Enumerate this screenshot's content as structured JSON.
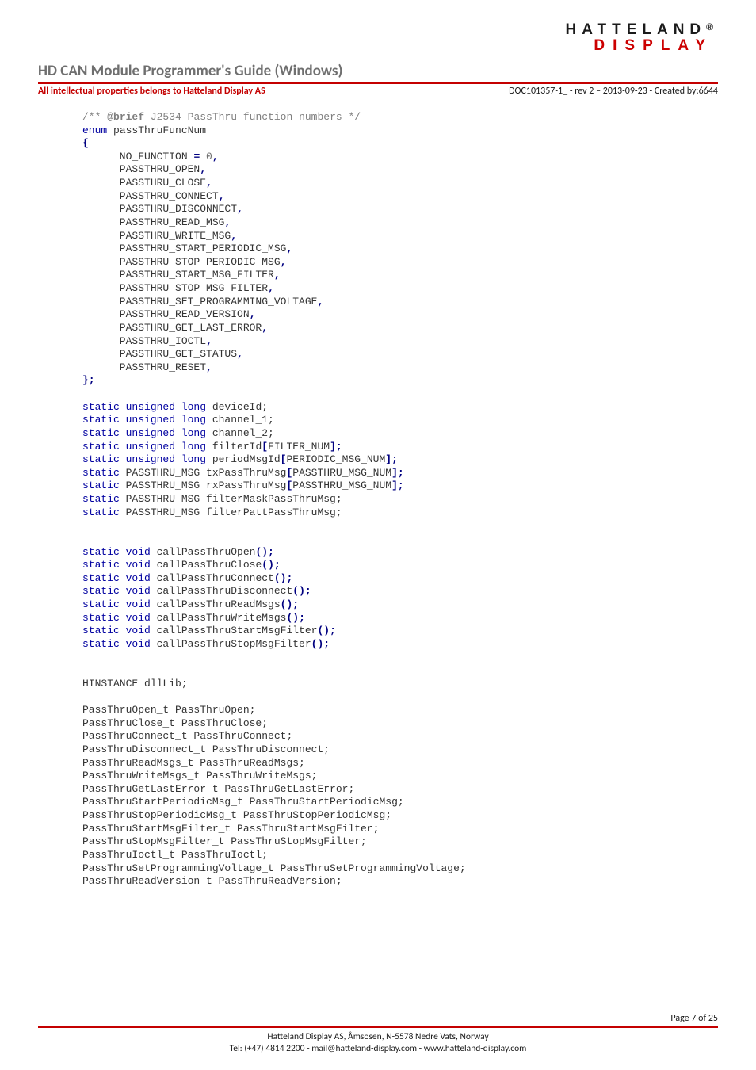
{
  "brand": {
    "line1": "HATTELAND",
    "reg": "®",
    "line2": "DISPLAY"
  },
  "header": {
    "title": "HD CAN Module Programmer's Guide (Windows)",
    "ip_line": "All intellectual properties  belongs to Hatteland Display AS",
    "docinfo": "DOC101357-1_ - rev 2 – 2013-09-23 - Created by:6644"
  },
  "code": {
    "comment_open": "/** ",
    "comment_tag": "@brief",
    "comment_text": " J2534 PassThru function numbers */",
    "enum_kw": "enum",
    "enum_name": " passThruFuncNum",
    "brace_open": "{",
    "first_item_name": "      NO_FUNCTION ",
    "eq": "=",
    "zero": " 0",
    "comma": ",",
    "enum_items": [
      "      PASSTHRU_OPEN",
      "      PASSTHRU_CLOSE",
      "      PASSTHRU_CONNECT",
      "      PASSTHRU_DISCONNECT",
      "      PASSTHRU_READ_MSG",
      "      PASSTHRU_WRITE_MSG",
      "      PASSTHRU_START_PERIODIC_MSG",
      "      PASSTHRU_STOP_PERIODIC_MSG",
      "      PASSTHRU_START_MSG_FILTER",
      "      PASSTHRU_STOP_MSG_FILTER",
      "      PASSTHRU_SET_PROGRAMMING_VOLTAGE",
      "      PASSTHRU_READ_VERSION",
      "      PASSTHRU_GET_LAST_ERROR",
      "      PASSTHRU_IOCTL",
      "      PASSTHRU_GET_STATUS",
      "      PASSTHRU_RESET"
    ],
    "brace_close": "};",
    "static_decls": [
      {
        "pre": "static unsigned long",
        "name": " deviceId;"
      },
      {
        "pre": "static unsigned long",
        "name": " channel_1;"
      },
      {
        "pre": "static unsigned long",
        "name": " channel_2;"
      },
      {
        "pre": "static unsigned long",
        "name": " filterId",
        "arr": "[",
        "arrn": "FILTER_NUM",
        "arrc": "];"
      },
      {
        "pre": "static unsigned long",
        "name": " periodMsgId",
        "arr": "[",
        "arrn": "PERIODIC_MSG_NUM",
        "arrc": "];"
      }
    ],
    "msg_decls": [
      {
        "kw": "static",
        "type": " PASSTHRU_MSG txPassThruMsg",
        "arr": "[",
        "arrn": "PASSTHRU_MSG_NUM",
        "arrc": "];"
      },
      {
        "kw": "static",
        "type": " PASSTHRU_MSG rxPassThruMsg",
        "arr": "[",
        "arrn": "PASSTHRU_MSG_NUM",
        "arrc": "];"
      },
      {
        "kw": "static",
        "type": " PASSTHRU_MSG filterMaskPassThruMsg;"
      },
      {
        "kw": "static",
        "type": " PASSTHRU_MSG filterPattPassThruMsg;"
      }
    ],
    "fn_decls": [
      "callPassThruOpen",
      "callPassThruClose",
      "callPassThruConnect",
      "callPassThruDisconnect",
      "callPassThruReadMsgs",
      "callPassThruWriteMsgs",
      "callPassThruStartMsgFilter",
      "callPassThruStopMsgFilter"
    ],
    "fn_pre": "static void",
    "fn_paren": "();",
    "hinst": "HINSTANCE dllLib;",
    "ptr_decls": [
      "PassThruOpen_t PassThruOpen;",
      "PassThruClose_t PassThruClose;",
      "PassThruConnect_t PassThruConnect;",
      "PassThruDisconnect_t PassThruDisconnect;",
      "PassThruReadMsgs_t PassThruReadMsgs;",
      "PassThruWriteMsgs_t PassThruWriteMsgs;",
      "PassThruGetLastError_t PassThruGetLastError;",
      "PassThruStartPeriodicMsg_t PassThruStartPeriodicMsg;",
      "PassThruStopPeriodicMsg_t PassThruStopPeriodicMsg;",
      "PassThruStartMsgFilter_t PassThruStartMsgFilter;",
      "PassThruStopMsgFilter_t PassThruStopMsgFilter;",
      "PassThruIoctl_t PassThruIoctl;",
      "PassThruSetProgrammingVoltage_t PassThruSetProgrammingVoltage;",
      "PassThruReadVersion_t PassThruReadVersion;"
    ]
  },
  "footer": {
    "page": "Page 7 of 25",
    "addr1": "Hatteland Display AS, Åmsosen, N-5578 Nedre Vats, Norway",
    "addr2": "Tel: (+47) 4814 2200 - mail@hatteland-display.com - www.hatteland-display.com"
  }
}
